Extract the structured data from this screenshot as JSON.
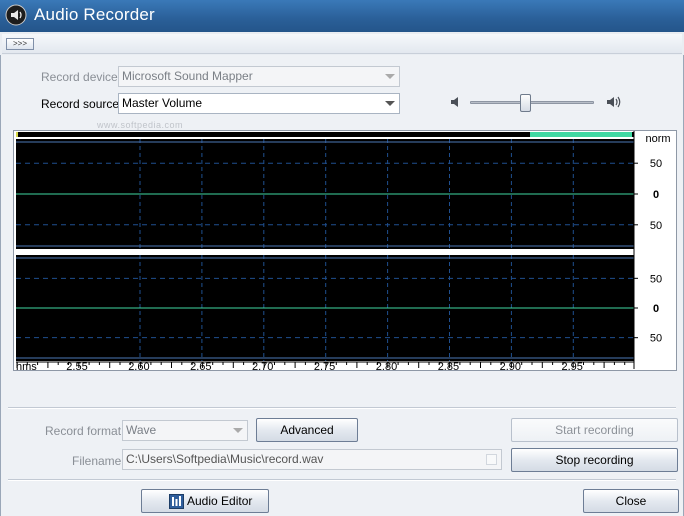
{
  "window": {
    "title": "Audio Recorder"
  },
  "toolbar": {
    "expand_label": ">>>"
  },
  "record": {
    "device_label": "Record device:",
    "device_value": "Microsoft Sound Mapper",
    "source_label": "Record source:",
    "source_value": "Master Volume"
  },
  "volume": {
    "level": 0.45
  },
  "watermark": "www.softpedia.com",
  "scope": {
    "right_scale_title": "norm",
    "channel_ticks": [
      "50",
      "0",
      "50"
    ],
    "time_unit": "hms",
    "time_ticks": [
      "2.55",
      "2.60",
      "2.65",
      "2.70",
      "2.75",
      "2.80",
      "2.85",
      "2.90",
      "2.95"
    ],
    "colors": {
      "background": "#000000",
      "signal": "#3fd8a2",
      "grid": "#1f4f8f",
      "border_line": "#4c77b6"
    }
  },
  "format": {
    "label": "Record format:",
    "value": "Wave",
    "advanced_button": "Advanced",
    "start_button": "Start recording",
    "filename_label": "Filename:",
    "filename_value": "C:\\Users\\Softpedia\\Music\\record.wav",
    "stop_button": "Stop recording"
  },
  "footer": {
    "audio_editor_button": "Audio Editor",
    "close_button": "Close"
  }
}
